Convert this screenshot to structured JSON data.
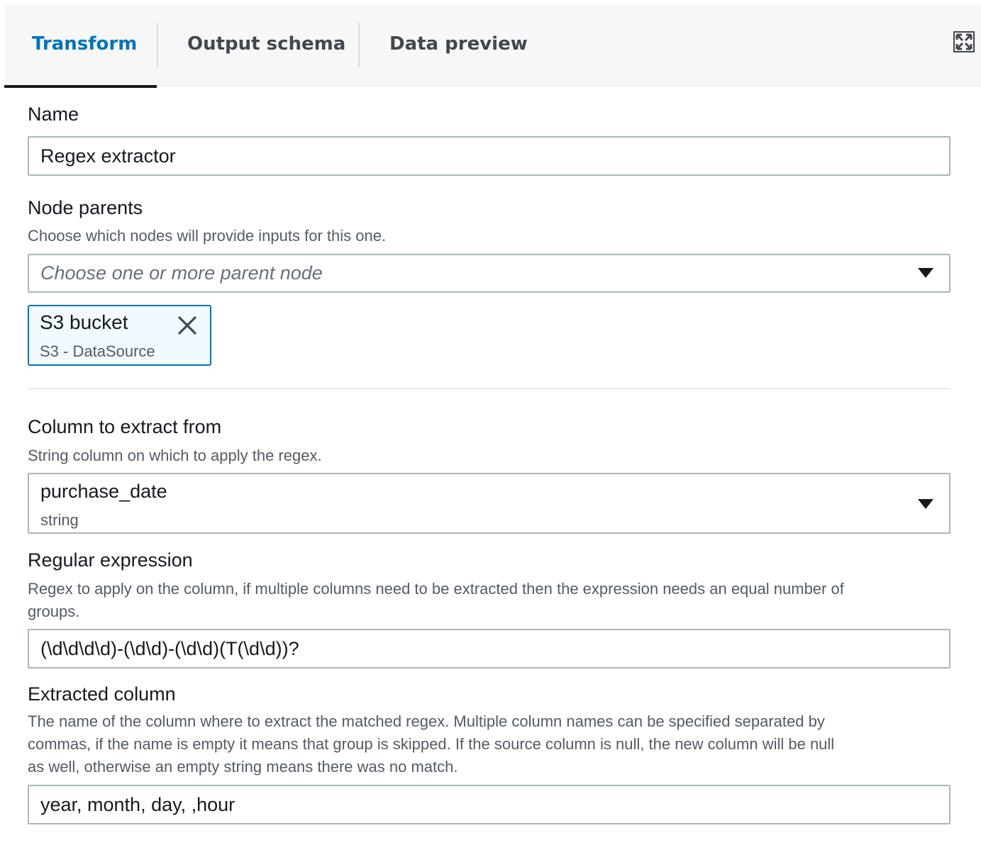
{
  "tabs": {
    "transform": "Transform",
    "output_schema": "Output schema",
    "data_preview": "Data preview"
  },
  "name_section": {
    "label": "Name",
    "value": "Regex extractor"
  },
  "node_parents": {
    "label": "Node parents",
    "description": "Choose which nodes will provide inputs for this one.",
    "placeholder": "Choose one or more parent node",
    "token": {
      "title": "S3 bucket",
      "subtitle": "S3 - DataSource"
    }
  },
  "column_section": {
    "label": "Column to extract from",
    "description": "String column on which to apply the regex.",
    "value": "purchase_date",
    "type": "string"
  },
  "regex_section": {
    "label": "Regular expression",
    "description_line1": "Regex to apply on the column, if multiple columns need to be extracted then the expression needs an equal number of",
    "description_line2": "groups.",
    "value": "(\\d\\d\\d\\d)-(\\d\\d)-(\\d\\d)(T(\\d\\d))?"
  },
  "extracted_section": {
    "label": "Extracted column",
    "description_line1": "The name of the column where to extract the matched regex. Multiple column names can be specified separated by",
    "description_line2": "commas, if the name is empty it means that group is skipped. If the source column is null, the new column will be null",
    "description_line3": "as well, otherwise an empty string means there was no match.",
    "value": "year, month, day, ,hour"
  },
  "icons": {
    "expand": "expand-arrows-icon",
    "dropdown": "caret-down-icon",
    "remove": "close-icon"
  },
  "colors": {
    "accent": "#0073bb",
    "token_bg": "#f1faff",
    "tabbar_bg": "#f7f7f7",
    "border": "#aab7b8",
    "muted_text": "#545b64"
  }
}
